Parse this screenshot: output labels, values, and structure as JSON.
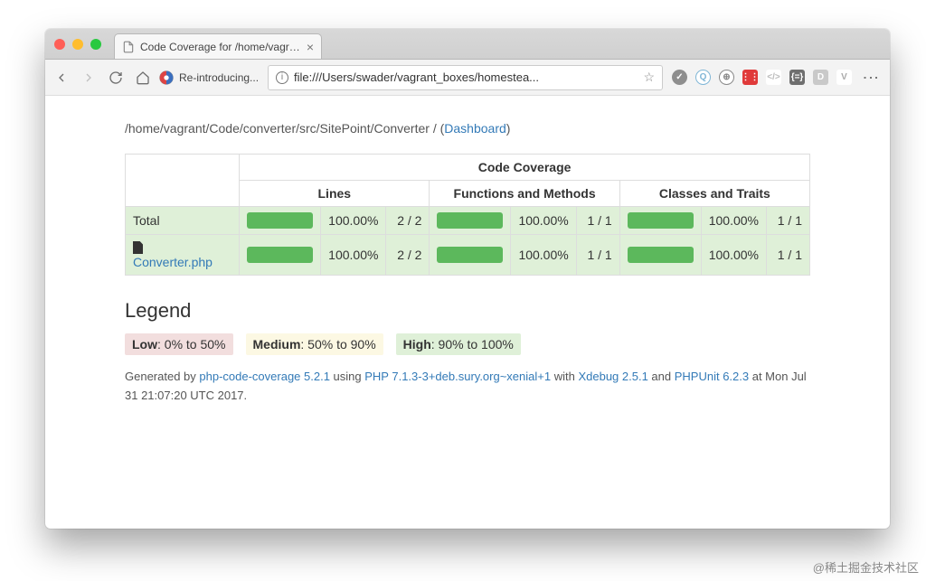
{
  "window": {
    "tab_title": "Code Coverage for /home/vagrant/C",
    "bookmark_label": "Re-introducing...",
    "url_display": "file:///Users/swader/vagrant_boxes/homestea..."
  },
  "ext_icons": [
    {
      "name": "check-icon",
      "shape": "circle",
      "bg": "#8e8e8e",
      "fg": "#fff",
      "glyph": "✓"
    },
    {
      "name": "q-icon",
      "shape": "circle",
      "bg": "#ffffff",
      "fg": "#7fb6d6",
      "glyph": "Q",
      "border": "#7fb6d6"
    },
    {
      "name": "globe-icon",
      "shape": "circle",
      "bg": "#ffffff",
      "fg": "#888",
      "glyph": "⊕",
      "border": "#888"
    },
    {
      "name": "grid-icon",
      "shape": "square",
      "bg": "#e03a3a",
      "fg": "#fff",
      "glyph": "⋮⋮"
    },
    {
      "name": "code-icon",
      "shape": "square",
      "bg": "#ffffff",
      "fg": "#bbb",
      "glyph": "</>"
    },
    {
      "name": "braces-icon",
      "shape": "square",
      "bg": "#6f6f6f",
      "fg": "#fff",
      "glyph": "{=}"
    },
    {
      "name": "d-icon",
      "shape": "square",
      "bg": "#c9c9c9",
      "fg": "#fff",
      "glyph": "D"
    },
    {
      "name": "v-icon",
      "shape": "square",
      "bg": "#ffffff",
      "fg": "#aaa",
      "glyph": "V"
    }
  ],
  "breadcrumb": {
    "path": "/home/vagrant/Code/converter/src/SitePoint/Converter",
    "sep": " / ",
    "dashboard_open": "(",
    "dashboard_label": "Dashboard",
    "dashboard_close": ")"
  },
  "table": {
    "title": "Code Coverage",
    "groups": [
      "Lines",
      "Functions and Methods",
      "Classes and Traits"
    ],
    "rows": [
      {
        "name": "Total",
        "link": false,
        "lines_pct": "100.00%",
        "lines_frac": "2 / 2",
        "func_pct": "100.00%",
        "func_frac": "1 / 1",
        "cls_pct": "100.00%",
        "cls_frac": "1 / 1"
      },
      {
        "name": "Converter.php",
        "link": true,
        "icon": true,
        "lines_pct": "100.00%",
        "lines_frac": "2 / 2",
        "func_pct": "100.00%",
        "func_frac": "1 / 1",
        "cls_pct": "100.00%",
        "cls_frac": "1 / 1"
      }
    ]
  },
  "legend": {
    "heading": "Legend",
    "low_label": "Low",
    "low_range": ": 0% to 50%",
    "med_label": "Medium",
    "med_range": ": 50% to 90%",
    "high_label": "High",
    "high_range": ": 90% to 100%"
  },
  "footer": {
    "pre": "Generated by ",
    "pcc": "php-code-coverage 5.2.1",
    "using": " using ",
    "php": "PHP 7.1.3-3+deb.sury.org~xenial+1",
    "with": " with ",
    "xdebug": "Xdebug 2.5.1",
    "and": " and ",
    "phpunit": "PHPUnit 6.2.3",
    "at": " at Mon Jul 31 21:07:20 UTC 2017."
  },
  "watermark": "@稀土掘金技术社区"
}
